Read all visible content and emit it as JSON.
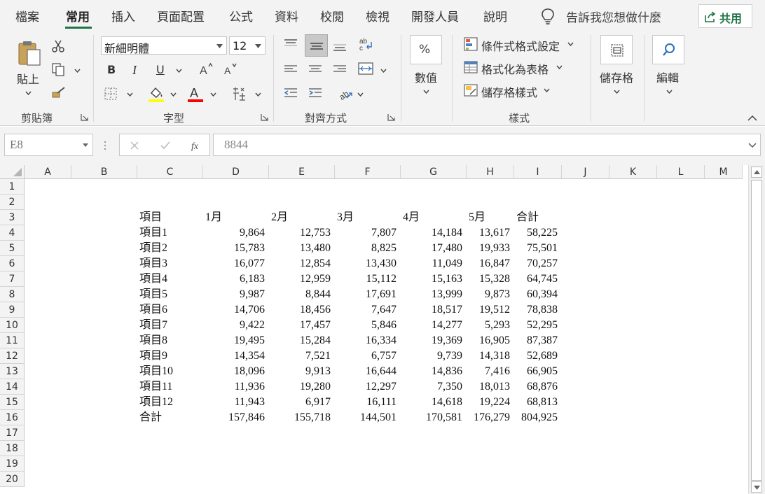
{
  "tabs": [
    {
      "label": "檔案"
    },
    {
      "label": "常用"
    },
    {
      "label": "插入"
    },
    {
      "label": "頁面配置"
    },
    {
      "label": "公式"
    },
    {
      "label": "資料"
    },
    {
      "label": "校閱"
    },
    {
      "label": "檢視"
    },
    {
      "label": "開發人員"
    },
    {
      "label": "說明"
    }
  ],
  "active_tab": "常用",
  "tell_me": "告訴我您想做什麼",
  "share_label": "共用",
  "ribbon": {
    "clipboard": {
      "group": "剪貼簿",
      "paste": "貼上"
    },
    "font": {
      "group": "字型",
      "font_name": "新細明體",
      "font_size": "12",
      "bold": "B",
      "italic": "I",
      "underline": "U"
    },
    "alignment": {
      "group": "對齊方式"
    },
    "number": {
      "group": "數值",
      "symbol": "%"
    },
    "styles": {
      "group": "樣式",
      "conditional": "條件式格式設定",
      "format_table": "格式化為表格",
      "cell_styles": "儲存格樣式"
    },
    "cells": {
      "label": "儲存格"
    },
    "editing": {
      "label": "編輯"
    }
  },
  "formula_bar": {
    "name_box": "E8",
    "formula": "8844"
  },
  "accent_color": "#217346",
  "highlight_color": "#ffff00",
  "font_color": "#ff0000",
  "columns": [
    "A",
    "B",
    "C",
    "D",
    "E",
    "F",
    "G",
    "H",
    "I",
    "J",
    "K",
    "L",
    "M"
  ],
  "rows": [
    "1",
    "2",
    "3",
    "4",
    "5",
    "6",
    "7",
    "8",
    "9",
    "10",
    "11",
    "12",
    "13",
    "14",
    "15",
    "16",
    "17",
    "18",
    "19",
    "20"
  ],
  "sheet": {
    "headers": [
      "項目",
      "1月",
      "2月",
      "3月",
      "4月",
      "5月",
      "合計"
    ],
    "data": [
      [
        "項目1",
        "9,864",
        "12,753",
        "7,807",
        "14,184",
        "13,617",
        "58,225"
      ],
      [
        "項目2",
        "15,783",
        "13,480",
        "8,825",
        "17,480",
        "19,933",
        "75,501"
      ],
      [
        "項目3",
        "16,077",
        "12,854",
        "13,430",
        "11,049",
        "16,847",
        "70,257"
      ],
      [
        "項目4",
        "6,183",
        "12,959",
        "15,112",
        "15,163",
        "15,328",
        "64,745"
      ],
      [
        "項目5",
        "9,987",
        "8,844",
        "17,691",
        "13,999",
        "9,873",
        "60,394"
      ],
      [
        "項目6",
        "14,706",
        "18,456",
        "7,647",
        "18,517",
        "19,512",
        "78,838"
      ],
      [
        "項目7",
        "9,422",
        "17,457",
        "5,846",
        "14,277",
        "5,293",
        "52,295"
      ],
      [
        "項目8",
        "19,495",
        "15,284",
        "16,334",
        "19,369",
        "16,905",
        "87,387"
      ],
      [
        "項目9",
        "14,354",
        "7,521",
        "6,757",
        "9,739",
        "14,318",
        "52,689"
      ],
      [
        "項目10",
        "18,096",
        "9,913",
        "16,644",
        "14,836",
        "7,416",
        "66,905"
      ],
      [
        "項目11",
        "11,936",
        "19,280",
        "12,297",
        "7,350",
        "18,013",
        "68,876"
      ],
      [
        "項目12",
        "11,943",
        "6,917",
        "16,111",
        "14,618",
        "19,224",
        "68,813"
      ],
      [
        "合計",
        "157,846",
        "155,718",
        "144,501",
        "170,581",
        "176,279",
        "804,925"
      ]
    ]
  }
}
